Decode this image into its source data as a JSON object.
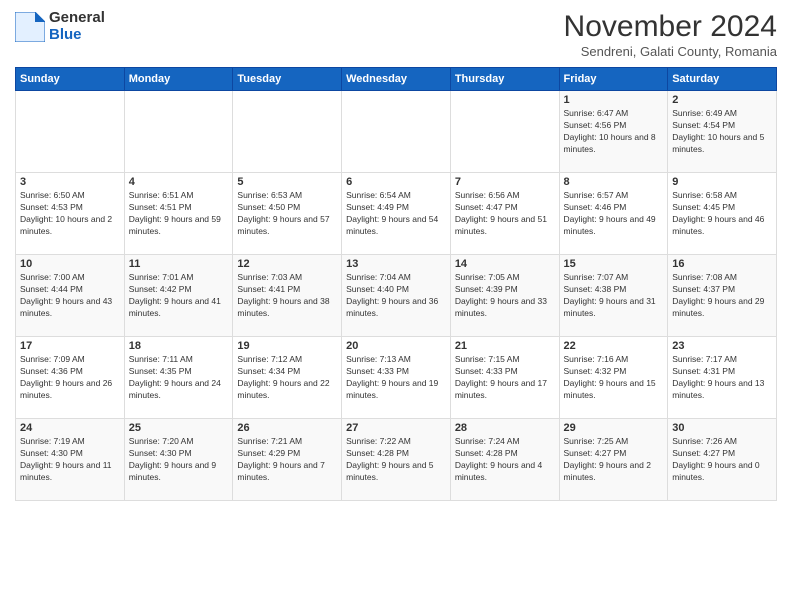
{
  "logo": {
    "general": "General",
    "blue": "Blue"
  },
  "title": "November 2024",
  "subtitle": "Sendreni, Galati County, Romania",
  "days_header": [
    "Sunday",
    "Monday",
    "Tuesday",
    "Wednesday",
    "Thursday",
    "Friday",
    "Saturday"
  ],
  "weeks": [
    [
      {
        "day": "",
        "info": ""
      },
      {
        "day": "",
        "info": ""
      },
      {
        "day": "",
        "info": ""
      },
      {
        "day": "",
        "info": ""
      },
      {
        "day": "",
        "info": ""
      },
      {
        "day": "1",
        "info": "Sunrise: 6:47 AM\nSunset: 4:56 PM\nDaylight: 10 hours and 8 minutes."
      },
      {
        "day": "2",
        "info": "Sunrise: 6:49 AM\nSunset: 4:54 PM\nDaylight: 10 hours and 5 minutes."
      }
    ],
    [
      {
        "day": "3",
        "info": "Sunrise: 6:50 AM\nSunset: 4:53 PM\nDaylight: 10 hours and 2 minutes."
      },
      {
        "day": "4",
        "info": "Sunrise: 6:51 AM\nSunset: 4:51 PM\nDaylight: 9 hours and 59 minutes."
      },
      {
        "day": "5",
        "info": "Sunrise: 6:53 AM\nSunset: 4:50 PM\nDaylight: 9 hours and 57 minutes."
      },
      {
        "day": "6",
        "info": "Sunrise: 6:54 AM\nSunset: 4:49 PM\nDaylight: 9 hours and 54 minutes."
      },
      {
        "day": "7",
        "info": "Sunrise: 6:56 AM\nSunset: 4:47 PM\nDaylight: 9 hours and 51 minutes."
      },
      {
        "day": "8",
        "info": "Sunrise: 6:57 AM\nSunset: 4:46 PM\nDaylight: 9 hours and 49 minutes."
      },
      {
        "day": "9",
        "info": "Sunrise: 6:58 AM\nSunset: 4:45 PM\nDaylight: 9 hours and 46 minutes."
      }
    ],
    [
      {
        "day": "10",
        "info": "Sunrise: 7:00 AM\nSunset: 4:44 PM\nDaylight: 9 hours and 43 minutes."
      },
      {
        "day": "11",
        "info": "Sunrise: 7:01 AM\nSunset: 4:42 PM\nDaylight: 9 hours and 41 minutes."
      },
      {
        "day": "12",
        "info": "Sunrise: 7:03 AM\nSunset: 4:41 PM\nDaylight: 9 hours and 38 minutes."
      },
      {
        "day": "13",
        "info": "Sunrise: 7:04 AM\nSunset: 4:40 PM\nDaylight: 9 hours and 36 minutes."
      },
      {
        "day": "14",
        "info": "Sunrise: 7:05 AM\nSunset: 4:39 PM\nDaylight: 9 hours and 33 minutes."
      },
      {
        "day": "15",
        "info": "Sunrise: 7:07 AM\nSunset: 4:38 PM\nDaylight: 9 hours and 31 minutes."
      },
      {
        "day": "16",
        "info": "Sunrise: 7:08 AM\nSunset: 4:37 PM\nDaylight: 9 hours and 29 minutes."
      }
    ],
    [
      {
        "day": "17",
        "info": "Sunrise: 7:09 AM\nSunset: 4:36 PM\nDaylight: 9 hours and 26 minutes."
      },
      {
        "day": "18",
        "info": "Sunrise: 7:11 AM\nSunset: 4:35 PM\nDaylight: 9 hours and 24 minutes."
      },
      {
        "day": "19",
        "info": "Sunrise: 7:12 AM\nSunset: 4:34 PM\nDaylight: 9 hours and 22 minutes."
      },
      {
        "day": "20",
        "info": "Sunrise: 7:13 AM\nSunset: 4:33 PM\nDaylight: 9 hours and 19 minutes."
      },
      {
        "day": "21",
        "info": "Sunrise: 7:15 AM\nSunset: 4:33 PM\nDaylight: 9 hours and 17 minutes."
      },
      {
        "day": "22",
        "info": "Sunrise: 7:16 AM\nSunset: 4:32 PM\nDaylight: 9 hours and 15 minutes."
      },
      {
        "day": "23",
        "info": "Sunrise: 7:17 AM\nSunset: 4:31 PM\nDaylight: 9 hours and 13 minutes."
      }
    ],
    [
      {
        "day": "24",
        "info": "Sunrise: 7:19 AM\nSunset: 4:30 PM\nDaylight: 9 hours and 11 minutes."
      },
      {
        "day": "25",
        "info": "Sunrise: 7:20 AM\nSunset: 4:30 PM\nDaylight: 9 hours and 9 minutes."
      },
      {
        "day": "26",
        "info": "Sunrise: 7:21 AM\nSunset: 4:29 PM\nDaylight: 9 hours and 7 minutes."
      },
      {
        "day": "27",
        "info": "Sunrise: 7:22 AM\nSunset: 4:28 PM\nDaylight: 9 hours and 5 minutes."
      },
      {
        "day": "28",
        "info": "Sunrise: 7:24 AM\nSunset: 4:28 PM\nDaylight: 9 hours and 4 minutes."
      },
      {
        "day": "29",
        "info": "Sunrise: 7:25 AM\nSunset: 4:27 PM\nDaylight: 9 hours and 2 minutes."
      },
      {
        "day": "30",
        "info": "Sunrise: 7:26 AM\nSunset: 4:27 PM\nDaylight: 9 hours and 0 minutes."
      }
    ]
  ]
}
